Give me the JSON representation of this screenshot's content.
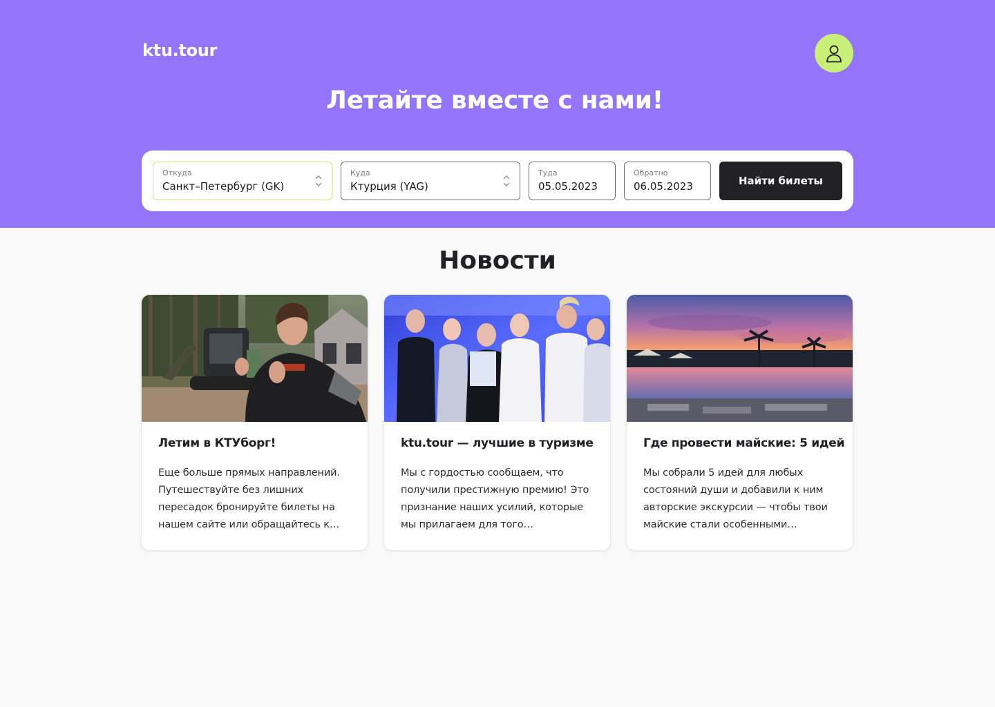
{
  "header": {
    "logo": "ktu.tour",
    "profile_icon": "user-icon",
    "title": "Летайте вместе с нами!"
  },
  "search": {
    "from": {
      "label": "Откуда",
      "value": "Санкт–Петербург (GK)"
    },
    "to": {
      "label": "Куда",
      "value": "Ктурция (YAG)"
    },
    "departure": {
      "label": "Туда",
      "value": "05.05.2023"
    },
    "return": {
      "label": "Обратно",
      "value": "06.05.2023"
    },
    "button_label": "Найти билеты"
  },
  "news": {
    "title": "Новости",
    "cards": [
      {
        "title": "Летим в КТУборг!",
        "text": "Еще больше прямых направлений. Путешествуйте без лишних пересадок бронируйте билеты на нашем сайте или обращайтесь к…"
      },
      {
        "title": "ktu.tour — лучшие в туризме",
        "text": "Мы с гордостью сообщаем, что получили престижную премию! Это признание наших усилий, которые мы прилагаем для того…"
      },
      {
        "title": "Где провести майские: 5 идей",
        "text": "Мы собрали 5 идей для любых состояний души и добавили к ним авторские экскурсии — чтобы твои майские стали особенными…"
      }
    ]
  },
  "colors": {
    "hero_bg": "#9475fa",
    "avatar_bg": "#c8ef78",
    "active_border": "#c3ea82",
    "button_bg": "#222226",
    "page_bg": "#f9f9f9"
  }
}
